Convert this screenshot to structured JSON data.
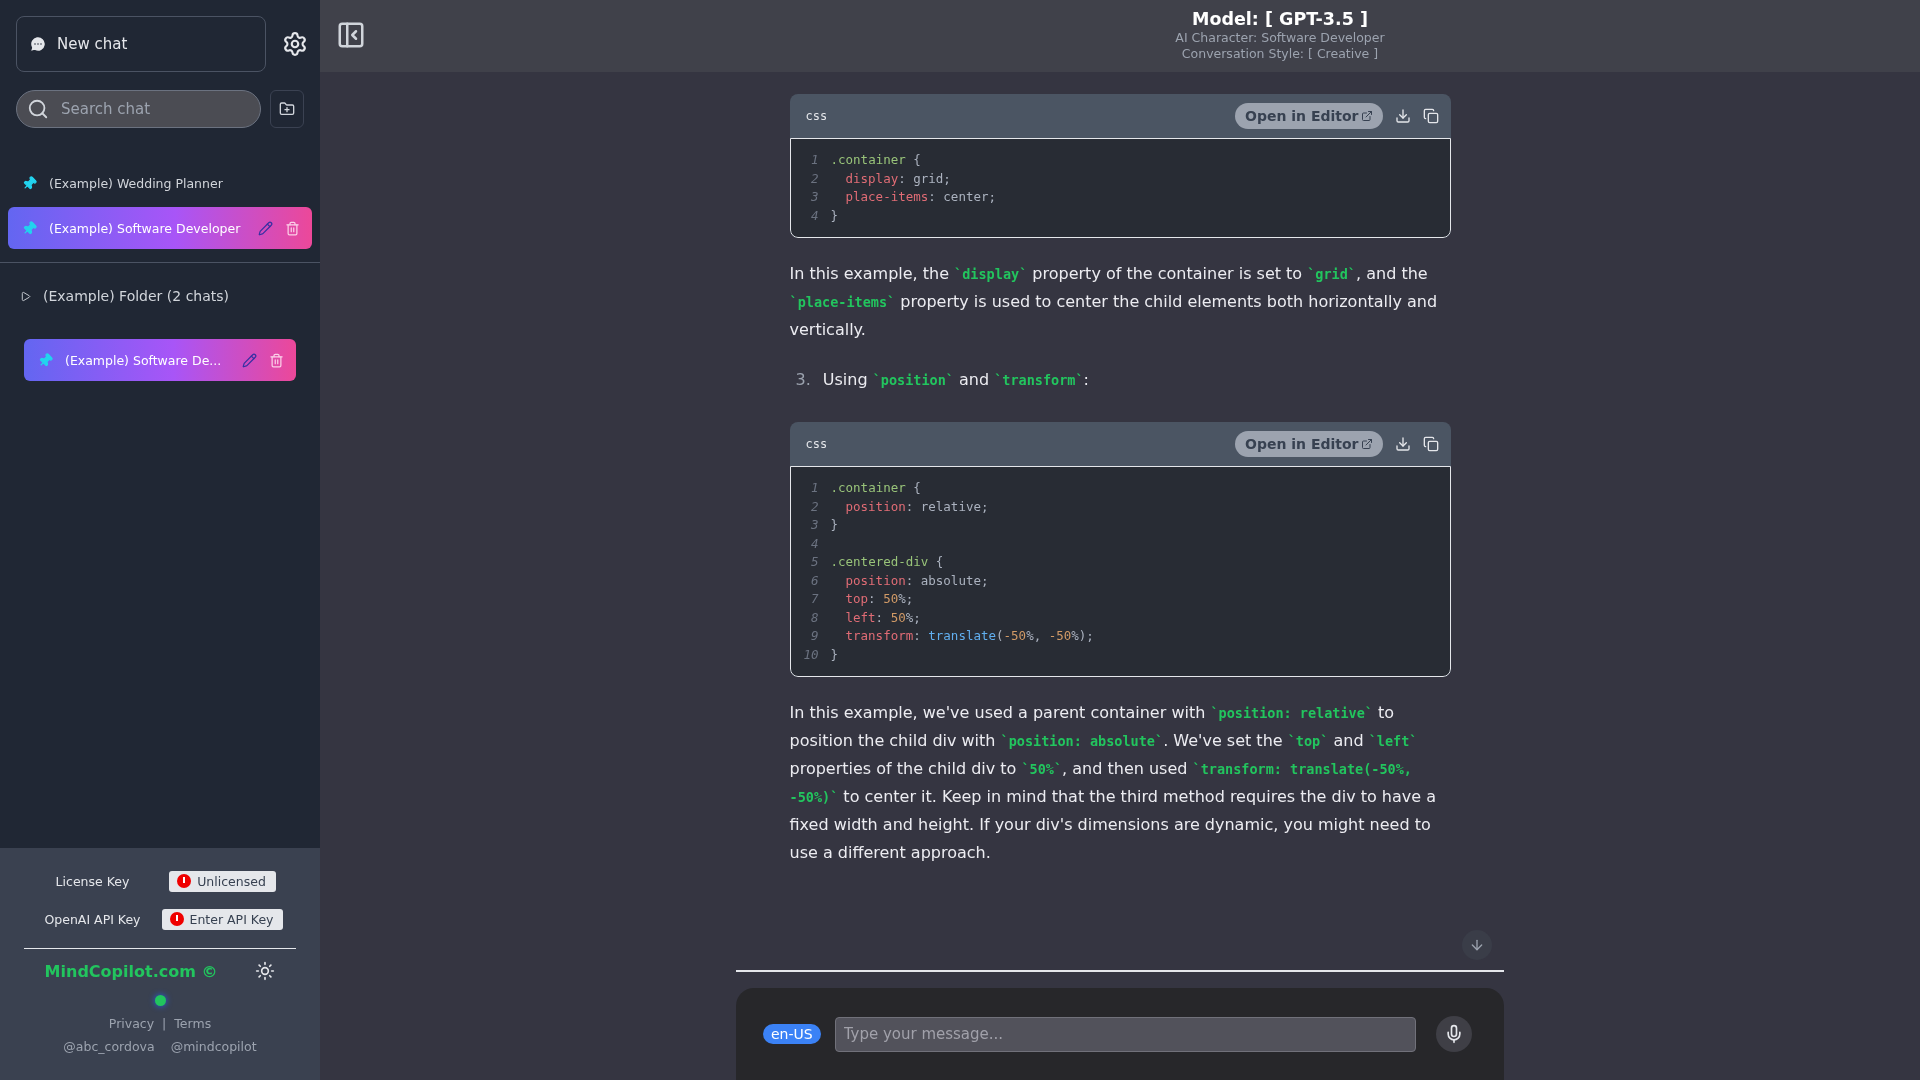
{
  "sidebar": {
    "new_chat": "New chat",
    "search": {
      "placeholder": "Search chat"
    },
    "chats": [
      {
        "title": "(Example) Wedding Planner",
        "selected": false
      },
      {
        "title": "(Example) Software Developer",
        "selected": true
      }
    ],
    "folders": [
      {
        "name": "(Example) Folder (2 chats)",
        "chats": [
          {
            "title": "(Example) Software De...",
            "selected": true
          }
        ]
      }
    ],
    "settings": [
      {
        "label": "License Key",
        "value": "Unlicensed"
      },
      {
        "label": "OpenAI API Key",
        "value": "Enter API Key"
      }
    ],
    "brand": "MindCopilot.com ©",
    "links": [
      "Privacy",
      "|",
      "Terms"
    ],
    "handles": [
      "@abc_cordova",
      "@mindcopilot"
    ]
  },
  "header": {
    "model": "Model: [ GPT-3.5 ]",
    "character": "AI Character: Software Developer",
    "style": "Conversation Style: [ Creative ]"
  },
  "message": [
    {
      "kind": "code",
      "language": "css",
      "action": "Open in Editor",
      "lines": [
        {
          "number": "1",
          "indented": false,
          "tokens": [
            {
              "kind": "selector",
              "s": ".container"
            },
            {
              "kind": "plain",
              "s": " {"
            }
          ]
        },
        {
          "number": "2",
          "indented": true,
          "tokens": [
            {
              "kind": "property",
              "s": "display"
            },
            {
              "kind": "plain",
              "s": ": grid;"
            }
          ]
        },
        {
          "number": "3",
          "indented": true,
          "tokens": [
            {
              "kind": "property",
              "s": "place-items"
            },
            {
              "kind": "plain",
              "s": ": center;"
            }
          ]
        },
        {
          "number": "4",
          "indented": false,
          "tokens": [
            {
              "kind": "plain",
              "s": "}"
            }
          ]
        }
      ]
    },
    {
      "kind": "paragraph",
      "parts": [
        {
          "kind": "text",
          "s": "In this example, the "
        },
        {
          "kind": "code",
          "s": "`display`"
        },
        {
          "kind": "text",
          "s": " property of the container is set to "
        },
        {
          "kind": "code",
          "s": "`grid`"
        },
        {
          "kind": "text",
          "s": ", and the "
        },
        {
          "kind": "code",
          "s": "`place-items`"
        },
        {
          "kind": "text",
          "s": " property is used to center the child elements both horizontally and vertically."
        }
      ]
    },
    {
      "kind": "list_item",
      "marker": "3.",
      "parts": [
        {
          "kind": "text",
          "s": "Using "
        },
        {
          "kind": "code",
          "s": "`position`"
        },
        {
          "kind": "text",
          "s": " and "
        },
        {
          "kind": "code",
          "s": "`transform`"
        },
        {
          "kind": "text",
          "s": ":"
        }
      ]
    },
    {
      "kind": "code",
      "language": "css",
      "action": "Open in Editor",
      "lines": [
        {
          "number": "1",
          "indented": false,
          "tokens": [
            {
              "kind": "selector",
              "s": ".container"
            },
            {
              "kind": "plain",
              "s": " {"
            }
          ]
        },
        {
          "number": "2",
          "indented": true,
          "tokens": [
            {
              "kind": "property",
              "s": "position"
            },
            {
              "kind": "plain",
              "s": ": relative;"
            }
          ]
        },
        {
          "number": "3",
          "indented": false,
          "tokens": [
            {
              "kind": "plain",
              "s": "}"
            }
          ]
        },
        {
          "number": "4"
        },
        {
          "number": "5",
          "indented": false,
          "tokens": [
            {
              "kind": "selector",
              "s": ".centered-div"
            },
            {
              "kind": "plain",
              "s": " {"
            }
          ]
        },
        {
          "number": "6",
          "indented": true,
          "tokens": [
            {
              "kind": "property",
              "s": "position"
            },
            {
              "kind": "plain",
              "s": ": absolute;"
            }
          ]
        },
        {
          "number": "7",
          "indented": true,
          "tokens": [
            {
              "kind": "property",
              "s": "top"
            },
            {
              "kind": "plain",
              "s": ": "
            },
            {
              "kind": "number",
              "s": "50"
            },
            {
              "kind": "plain",
              "s": "%;"
            }
          ]
        },
        {
          "number": "8",
          "indented": true,
          "tokens": [
            {
              "kind": "property",
              "s": "left"
            },
            {
              "kind": "plain",
              "s": ": "
            },
            {
              "kind": "number",
              "s": "50"
            },
            {
              "kind": "plain",
              "s": "%;"
            }
          ]
        },
        {
          "number": "9",
          "indented": true,
          "tokens": [
            {
              "kind": "property",
              "s": "transform"
            },
            {
              "kind": "plain",
              "s": ": "
            },
            {
              "kind": "function",
              "s": "translate"
            },
            {
              "kind": "plain",
              "s": "("
            },
            {
              "kind": "number",
              "s": "-50"
            },
            {
              "kind": "plain",
              "s": "%, "
            },
            {
              "kind": "number",
              "s": "-50"
            },
            {
              "kind": "plain",
              "s": "%);"
            }
          ]
        },
        {
          "number": "10",
          "indented": false,
          "tokens": [
            {
              "kind": "plain",
              "s": "}"
            }
          ]
        }
      ]
    },
    {
      "kind": "paragraph",
      "parts": [
        {
          "kind": "text",
          "s": "In this example, we've used a parent container with "
        },
        {
          "kind": "code",
          "s": "`position: relative`"
        },
        {
          "kind": "text",
          "s": " to position the child div with "
        },
        {
          "kind": "code",
          "s": "`position: absolute`"
        },
        {
          "kind": "text",
          "s": ". We've set the "
        },
        {
          "kind": "code",
          "s": "`top`"
        },
        {
          "kind": "text",
          "s": " and "
        },
        {
          "kind": "code",
          "s": "`left`"
        },
        {
          "kind": "text",
          "s": " properties of the child div to "
        },
        {
          "kind": "code",
          "s": "`50%`"
        },
        {
          "kind": "text",
          "s": ", and then used "
        },
        {
          "kind": "code",
          "s": "`transform: translate(-50%, -50%)`"
        },
        {
          "kind": "text",
          "s": " to center it. Keep in mind that the third method requires the div to have a fixed width and height. If your div's dimensions are dynamic, you might need to use a different approach."
        }
      ]
    }
  ],
  "composer": {
    "language": "en-US",
    "placeholder": "Type your message..."
  }
}
